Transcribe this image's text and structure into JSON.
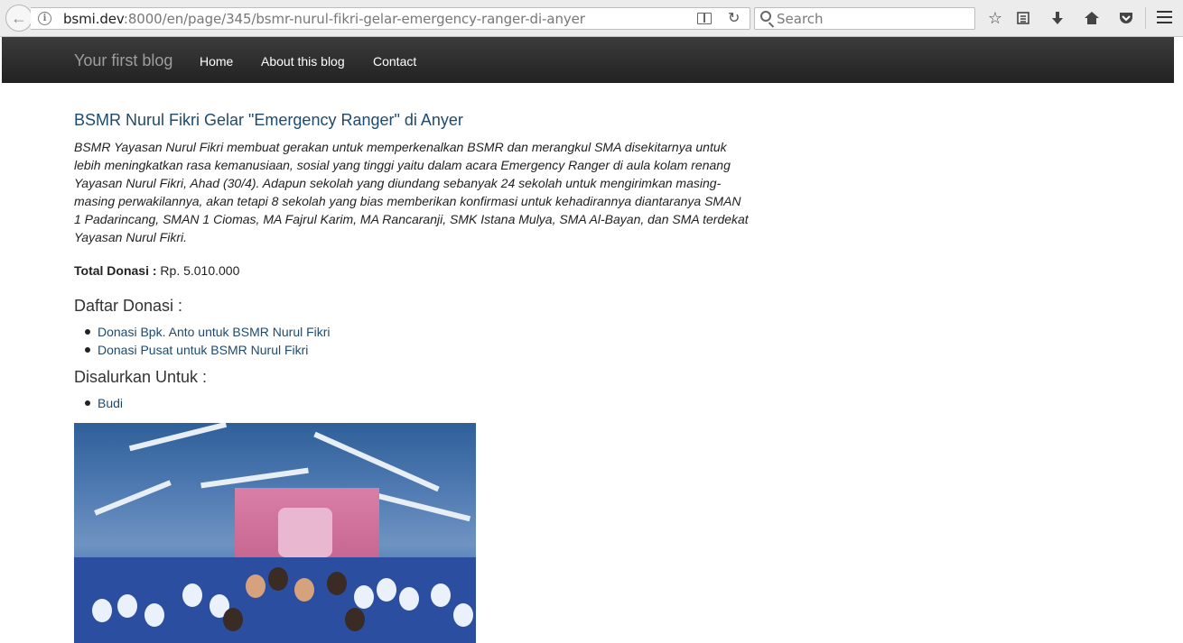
{
  "browser": {
    "url_host": "bsmi.dev",
    "url_rest": ":8000/en/page/345/bsmr-nurul-fikri-gelar-emergency-ranger-di-anyer",
    "search_placeholder": "Search"
  },
  "navbar": {
    "brand": "Your first blog",
    "links": [
      "Home",
      "About this blog",
      "Contact"
    ]
  },
  "post": {
    "title": "BSMR Nurul Fikri Gelar \"Emergency Ranger\" di Anyer",
    "excerpt": "BSMR Yayasan Nurul Fikri membuat gerakan untuk memperkenalkan BSMR dan merangkul SMA disekitarnya untuk lebih meningkatkan rasa kemanusiaan, sosial yang tinggi yaitu dalam acara Emergency Ranger di aula kolam renang Yayasan Nurul Fikri, Ahad (30/4). Adapun sekolah yang diundang sebanyak 24 sekolah untuk mengirimkan masing-masing perwakilannya, akan tetapi 8 sekolah yang bias memberikan konfirmasi untuk kehadirannya diantaranya SMAN 1 Padarincang, SMAN 1 Ciomas, MA Fajrul Karim, MA Rancaranji, SMK Istana Mulya, SMA Al-Bayan, dan SMA terdekat Yayasan Nurul Fikri.",
    "total_label": "Total Donasi :",
    "total_value": "Rp. 5.010.000",
    "donations_heading": "Daftar Donasi :",
    "donations": [
      "Donasi Bpk. Anto untuk BSMR Nurul Fikri",
      "Donasi Pusat untuk BSMR Nurul Fikri"
    ],
    "distributed_heading": "Disalurkan Untuk :",
    "recipients": [
      "Budi"
    ]
  },
  "colors": {
    "navbar": "#222222",
    "link": "#1f4a6e",
    "brand": "#9d9d9d"
  }
}
